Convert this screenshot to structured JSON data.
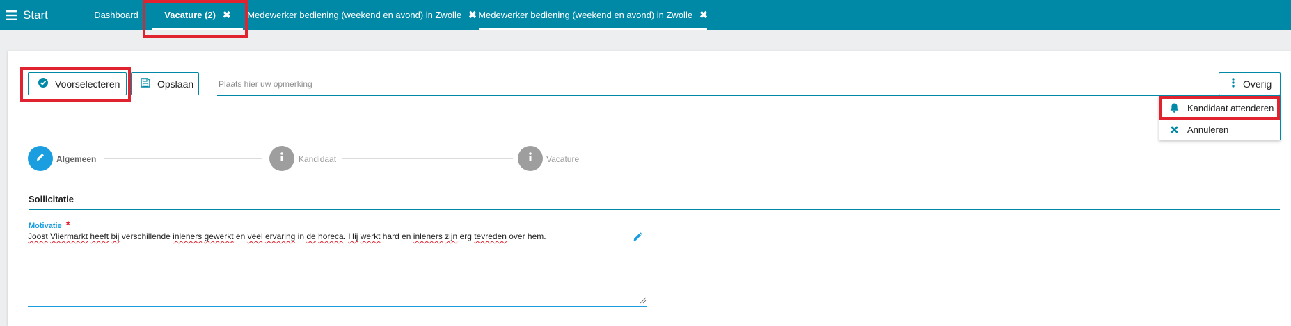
{
  "topbar": {
    "menu_label": "Start",
    "tabs": [
      {
        "label": "Dashboard"
      },
      {
        "label": "Vacature (2)",
        "close": "✖"
      },
      {
        "label": "Medewerker bediening (weekend en avond) in Zwolle",
        "close": "✖"
      },
      {
        "label": "Medewerker bediening (weekend en avond) in Zwolle",
        "close": "✖"
      }
    ]
  },
  "toolbar": {
    "preselect_label": "Voorselecteren",
    "save_label": "Opslaan",
    "remark_placeholder": "Plaats hier uw opmerking",
    "more_label": "Overig"
  },
  "dropdown": {
    "items": [
      {
        "label": "Kandidaat attenderen",
        "icon": "bell-icon"
      },
      {
        "label": "Annuleren",
        "icon": "close-icon"
      }
    ]
  },
  "steps": [
    {
      "label": "Algemeen",
      "icon": "pencil-icon",
      "active": true
    },
    {
      "label": "Kandidaat",
      "icon": "info-icon",
      "active": false
    },
    {
      "label": "Vacature",
      "icon": "info-icon",
      "active": false
    }
  ],
  "form": {
    "section_title": "Sollicitatie",
    "motivation_label": "Motivatie",
    "required_marker": "*",
    "motivation_words": [
      "Joost",
      " ",
      "Vliermarkt",
      " ",
      "heeft",
      " ",
      "bij",
      " verschillende ",
      "inleners",
      " ",
      "gewerkt",
      " en ",
      "veel",
      " ",
      "ervaring",
      " in ",
      "de",
      " ",
      "horeca",
      ". ",
      "Hij",
      " ",
      "werkt",
      " hard en ",
      "inleners",
      " ",
      "zijn",
      " erg ",
      "tevreden",
      " over hem."
    ]
  },
  "colors": {
    "brand": "#0089a7",
    "accent": "#1a9ee0",
    "highlight": "#e0232f",
    "inactive_step": "#9e9e9e"
  }
}
